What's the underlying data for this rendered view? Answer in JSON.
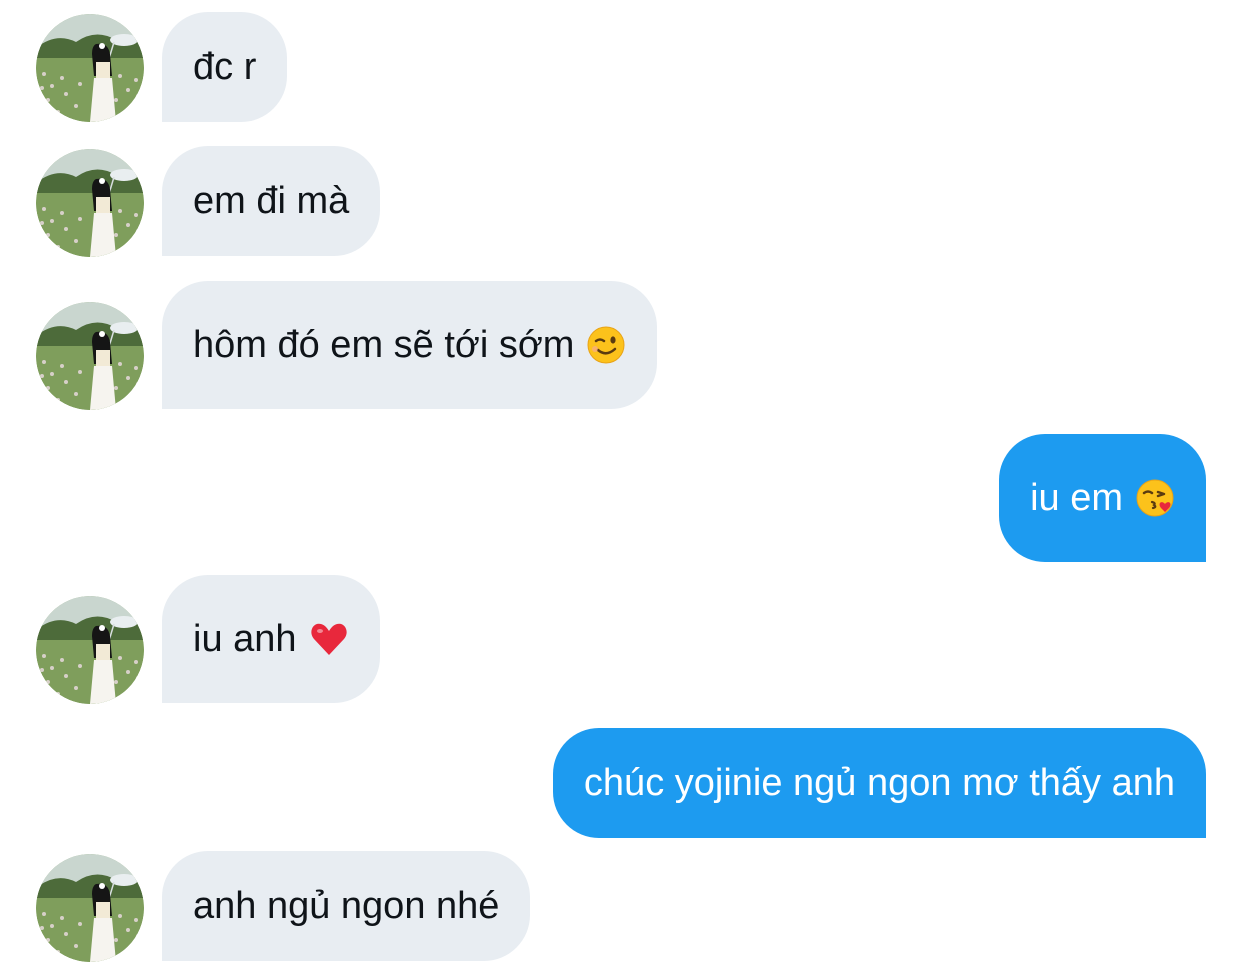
{
  "conversation": {
    "messages": [
      {
        "direction": "received",
        "text": "đc r"
      },
      {
        "direction": "received",
        "text": "em đi mà"
      },
      {
        "direction": "received",
        "text": "hôm đó em sẽ tới sớm",
        "emoji": "winking-face-emoji"
      },
      {
        "direction": "sent",
        "text": "iu em",
        "emoji": "kissing-face-with-heart-emoji"
      },
      {
        "direction": "received",
        "text": "iu anh",
        "emoji": "red-heart-emoji"
      },
      {
        "direction": "sent",
        "text": "chúc yojinie ngủ ngon mơ thấy anh"
      },
      {
        "direction": "received",
        "text": "anh ngủ ngon nhé"
      }
    ]
  },
  "colors": {
    "received_bubble": "#e8edf2",
    "received_text": "#0f1419",
    "sent_bubble": "#1d9bf0",
    "sent_text": "#ffffff",
    "background": "#ffffff"
  },
  "icons": {
    "avatar": "profile-photo-avatar",
    "wink": "winking-face-emoji",
    "kiss": "kissing-face-with-heart-emoji",
    "heart": "red-heart-emoji"
  }
}
